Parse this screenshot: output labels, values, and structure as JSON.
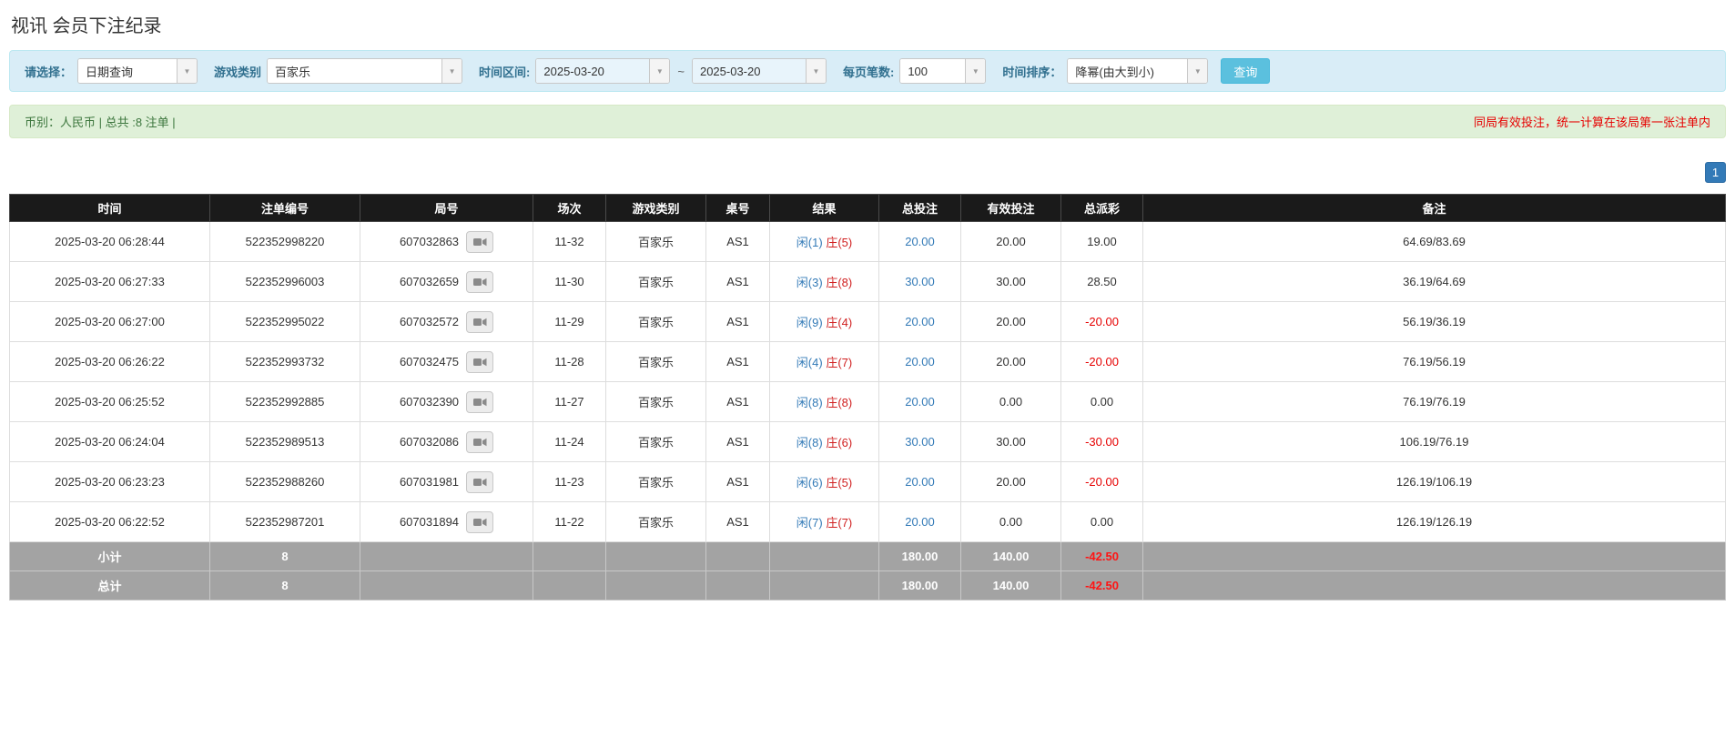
{
  "page_title": "视讯 会员下注纪录",
  "filters": {
    "query_type_label": "请选择：",
    "query_type_value": "日期查询",
    "game_type_label": "游戏类别",
    "game_type_value": "百家乐",
    "time_range_label": "时间区间:",
    "date_from": "2025-03-20",
    "date_separator": "~",
    "date_to": "2025-03-20",
    "page_size_label": "每页笔数:",
    "page_size_value": "100",
    "sort_label": "时间排序：",
    "sort_value": "降幂(由大到小)",
    "search_button_label": "查询"
  },
  "summary": {
    "currency_info": "币别：人民币 | 总共 :8 注单 |",
    "notice": "同局有效投注，统一计算在该局第一张注单内"
  },
  "pagination": {
    "current_page": "1"
  },
  "table": {
    "headers": [
      "时间",
      "注单编号",
      "局号",
      "场次",
      "游戏类别",
      "桌号",
      "结果",
      "总投注",
      "有效投注",
      "总派彩",
      "备注"
    ],
    "rows": [
      {
        "time": "2025-03-20 06:28:44",
        "bet_id": "522352998220",
        "round_id": "607032863",
        "session": "11-32",
        "game_type": "百家乐",
        "table_no": "AS1",
        "result_player": "闲(1)",
        "result_banker": "庄(5)",
        "total_bet": "20.00",
        "valid_bet": "20.00",
        "payout": "19.00",
        "note": "64.69/83.69"
      },
      {
        "time": "2025-03-20 06:27:33",
        "bet_id": "522352996003",
        "round_id": "607032659",
        "session": "11-30",
        "game_type": "百家乐",
        "table_no": "AS1",
        "result_player": "闲(3)",
        "result_banker": "庄(8)",
        "total_bet": "30.00",
        "valid_bet": "30.00",
        "payout": "28.50",
        "note": "36.19/64.69"
      },
      {
        "time": "2025-03-20 06:27:00",
        "bet_id": "522352995022",
        "round_id": "607032572",
        "session": "11-29",
        "game_type": "百家乐",
        "table_no": "AS1",
        "result_player": "闲(9)",
        "result_banker": "庄(4)",
        "total_bet": "20.00",
        "valid_bet": "20.00",
        "payout": "-20.00",
        "note": "56.19/36.19"
      },
      {
        "time": "2025-03-20 06:26:22",
        "bet_id": "522352993732",
        "round_id": "607032475",
        "session": "11-28",
        "game_type": "百家乐",
        "table_no": "AS1",
        "result_player": "闲(4)",
        "result_banker": "庄(7)",
        "total_bet": "20.00",
        "valid_bet": "20.00",
        "payout": "-20.00",
        "note": "76.19/56.19"
      },
      {
        "time": "2025-03-20 06:25:52",
        "bet_id": "522352992885",
        "round_id": "607032390",
        "session": "11-27",
        "game_type": "百家乐",
        "table_no": "AS1",
        "result_player": "闲(8)",
        "result_banker": "庄(8)",
        "total_bet": "20.00",
        "valid_bet": "0.00",
        "payout": "0.00",
        "note": "76.19/76.19"
      },
      {
        "time": "2025-03-20 06:24:04",
        "bet_id": "522352989513",
        "round_id": "607032086",
        "session": "11-24",
        "game_type": "百家乐",
        "table_no": "AS1",
        "result_player": "闲(8)",
        "result_banker": "庄(6)",
        "total_bet": "30.00",
        "valid_bet": "30.00",
        "payout": "-30.00",
        "note": "106.19/76.19"
      },
      {
        "time": "2025-03-20 06:23:23",
        "bet_id": "522352988260",
        "round_id": "607031981",
        "session": "11-23",
        "game_type": "百家乐",
        "table_no": "AS1",
        "result_player": "闲(6)",
        "result_banker": "庄(5)",
        "total_bet": "20.00",
        "valid_bet": "20.00",
        "payout": "-20.00",
        "note": "126.19/106.19"
      },
      {
        "time": "2025-03-20 06:22:52",
        "bet_id": "522352987201",
        "round_id": "607031894",
        "session": "11-22",
        "game_type": "百家乐",
        "table_no": "AS1",
        "result_player": "闲(7)",
        "result_banker": "庄(7)",
        "total_bet": "20.00",
        "valid_bet": "0.00",
        "payout": "0.00",
        "note": "126.19/126.19"
      }
    ],
    "subtotal": {
      "label": "小计",
      "count": "8",
      "total_bet": "180.00",
      "valid_bet": "140.00",
      "total_payout": "-42.50"
    },
    "grand_total": {
      "label": "总计",
      "count": "8",
      "total_bet": "180.00",
      "valid_bet": "140.00",
      "total_payout": "-42.50"
    }
  },
  "icons": {
    "dropdown_arrow": "▼"
  },
  "colors": {
    "player_blue": "#337ab7",
    "banker_red": "#d01f1f",
    "negative_red": "#e60000",
    "filter_bar_bg": "#d9edf7",
    "filter_label_text": "#31708f",
    "summary_bar_bg": "#dff0d8",
    "summary_text_green": "#3c763d",
    "table_header_bg": "#1a1a1a",
    "total_row_bg": "#a3a3a3",
    "search_button_bg": "#5bc0de",
    "pagination_bg": "#337ab7"
  }
}
